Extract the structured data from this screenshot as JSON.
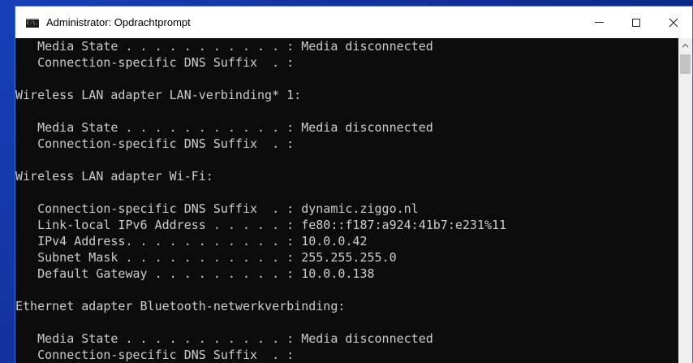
{
  "window": {
    "title": "Administrator: Opdrachtprompt",
    "icon_text": "C:\\."
  },
  "controls": {
    "minimize_icon": "minimize-icon",
    "maximize_icon": "maximize-icon",
    "close_icon": "close-icon"
  },
  "console": {
    "lines": [
      "   Media State . . . . . . . . . . . : Media disconnected",
      "   Connection-specific DNS Suffix  . :",
      "",
      "Wireless LAN adapter LAN-verbinding* 1:",
      "",
      "   Media State . . . . . . . . . . . : Media disconnected",
      "   Connection-specific DNS Suffix  . :",
      "",
      "Wireless LAN adapter Wi-Fi:",
      "",
      "   Connection-specific DNS Suffix  . : dynamic.ziggo.nl",
      "   Link-local IPv6 Address . . . . . : fe80::f187:a924:41b7:e231%11",
      "   IPv4 Address. . . . . . . . . . . : 10.0.0.42",
      "   Subnet Mask . . . . . . . . . . . : 255.255.255.0",
      "   Default Gateway . . . . . . . . . : 10.0.0.138",
      "",
      "Ethernet adapter Bluetooth-netwerkverbinding:",
      "",
      "   Media State . . . . . . . . . . . : Media disconnected",
      "   Connection-specific DNS Suffix  . :"
    ]
  },
  "colors": {
    "console_background": "#0c0c0c",
    "console_text": "#cccccc",
    "desktop": "#1740b8",
    "titlebar": "#ffffff"
  }
}
